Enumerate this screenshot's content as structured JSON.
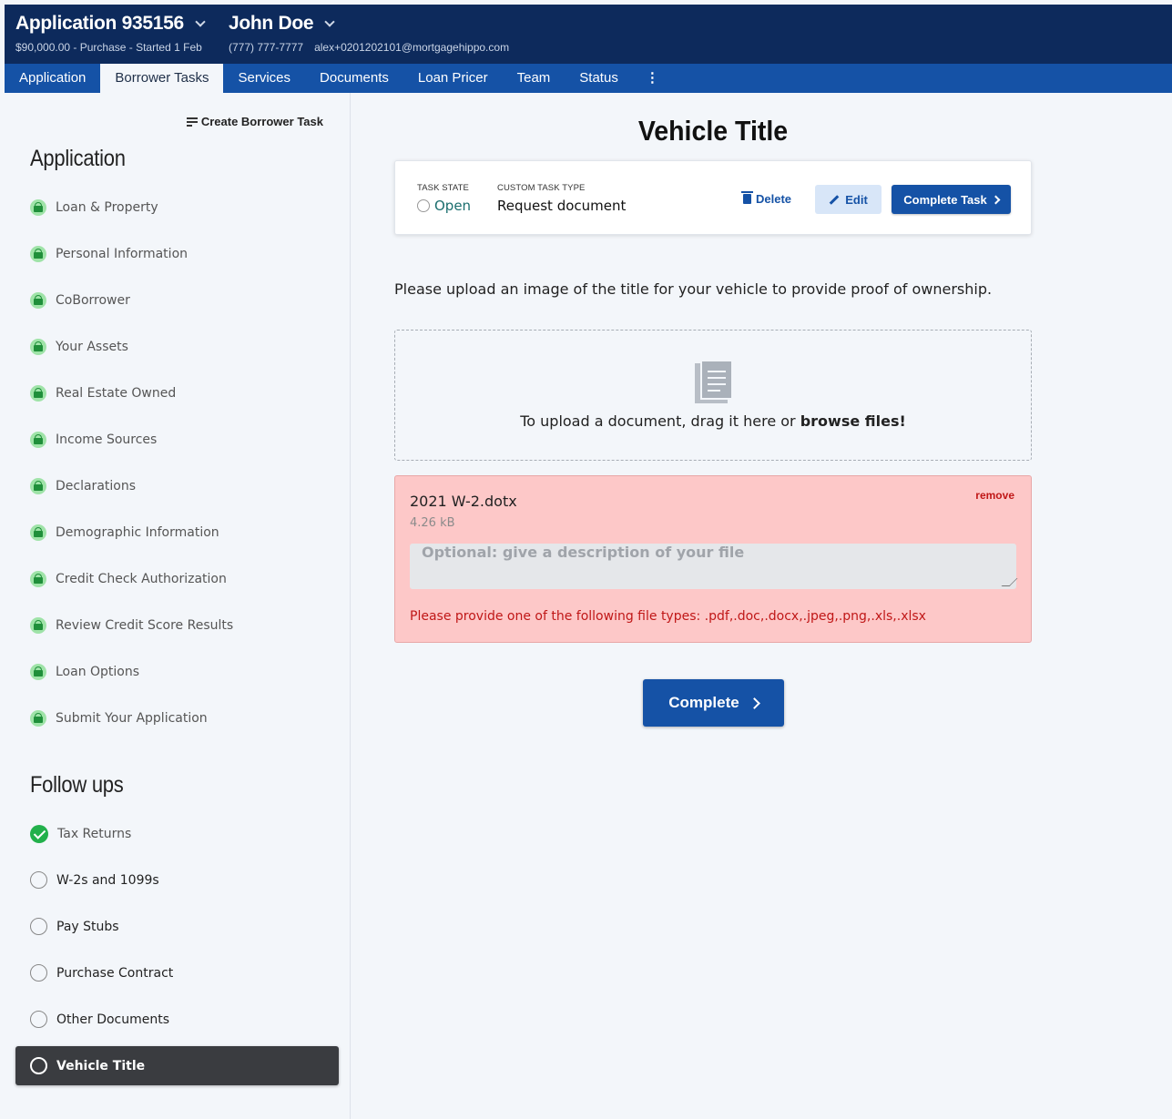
{
  "header": {
    "app_title": "Application 935156",
    "app_sub": "$90,000.00 - Purchase - Started 1 Feb",
    "user_name": "John Doe",
    "user_phone": "(777) 777-7777",
    "user_email": "alex+0201202101@mortgagehippo.com"
  },
  "tabs": [
    {
      "label": "Application"
    },
    {
      "label": "Borrower Tasks",
      "active": true
    },
    {
      "label": "Services"
    },
    {
      "label": "Documents"
    },
    {
      "label": "Loan Pricer"
    },
    {
      "label": "Team"
    },
    {
      "label": "Status"
    },
    {
      "label": "⋮"
    }
  ],
  "sidebar": {
    "create_task_label": "Create Borrower Task",
    "application_title": "Application",
    "application_items": [
      {
        "label": "Loan & Property",
        "status": "locked"
      },
      {
        "label": "Personal Information",
        "status": "locked"
      },
      {
        "label": "CoBorrower",
        "status": "locked"
      },
      {
        "label": "Your Assets",
        "status": "locked"
      },
      {
        "label": "Real Estate Owned",
        "status": "locked"
      },
      {
        "label": "Income Sources",
        "status": "locked"
      },
      {
        "label": "Declarations",
        "status": "locked"
      },
      {
        "label": "Demographic Information",
        "status": "locked"
      },
      {
        "label": "Credit Check Authorization",
        "status": "locked"
      },
      {
        "label": "Review Credit Score Results",
        "status": "locked"
      },
      {
        "label": "Loan Options",
        "status": "locked"
      },
      {
        "label": "Submit Your Application",
        "status": "locked"
      }
    ],
    "followups_title": "Follow ups",
    "followup_items": [
      {
        "label": "Tax Returns",
        "status": "done"
      },
      {
        "label": "W-2s and 1099s",
        "status": "open"
      },
      {
        "label": "Pay Stubs",
        "status": "open"
      },
      {
        "label": "Purchase Contract",
        "status": "open"
      },
      {
        "label": "Other Documents",
        "status": "open"
      },
      {
        "label": "Vehicle Title",
        "status": "active"
      }
    ]
  },
  "main": {
    "title": "Vehicle Title",
    "task_card": {
      "state_label": "Task State",
      "state_value": "Open",
      "type_label": "Custom Task Type",
      "type_value": "Request document",
      "delete_label": "Delete",
      "edit_label": "Edit",
      "complete_task_label": "Complete Task"
    },
    "instructions": "Please upload an image of the title for your vehicle to provide proof of ownership.",
    "dropzone": {
      "text": "To upload a document, drag it here or ",
      "link": "browse files!"
    },
    "file": {
      "name": "2021 W-2.dotx",
      "size": "4.26 kB",
      "remove_label": "remove",
      "description_placeholder": "Optional: give a description of your file",
      "error": "Please provide one of the following file types: .pdf,.doc,.docx,.jpeg,.png,.xls,.xlsx"
    },
    "complete_label": "Complete"
  },
  "colors": {
    "header_bg": "#0d2a5c",
    "nav_bg": "#1552a6",
    "accent": "#1552a6",
    "error": "#c01717",
    "error_bg": "#fdc8c8",
    "success": "#22b04b"
  }
}
